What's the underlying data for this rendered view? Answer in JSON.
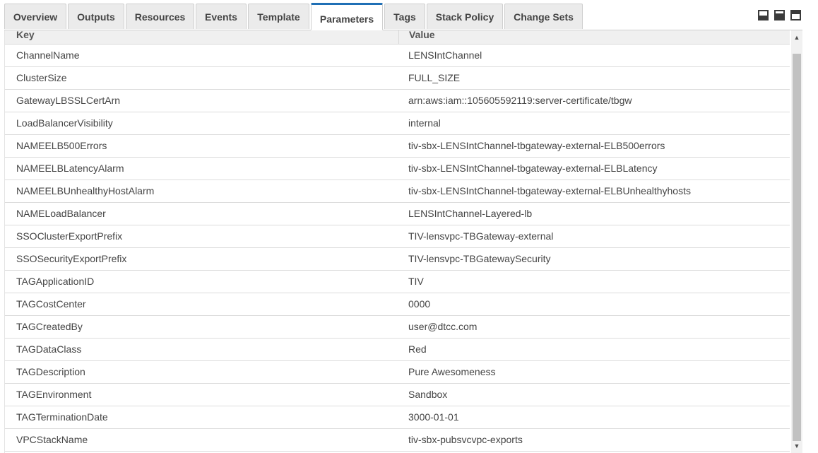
{
  "tabs": [
    {
      "label": "Overview"
    },
    {
      "label": "Outputs"
    },
    {
      "label": "Resources"
    },
    {
      "label": "Events"
    },
    {
      "label": "Template"
    },
    {
      "label": "Parameters"
    },
    {
      "label": "Tags"
    },
    {
      "label": "Stack Policy"
    },
    {
      "label": "Change Sets"
    }
  ],
  "active_tab": "Parameters",
  "table": {
    "headers": {
      "key": "Key",
      "value": "Value"
    },
    "rows": [
      {
        "key": "ChannelName",
        "value": "LENSIntChannel"
      },
      {
        "key": "ClusterSize",
        "value": "FULL_SIZE"
      },
      {
        "key": "GatewayLBSSLCertArn",
        "value": "arn:aws:iam::105605592119:server-certificate/tbgw"
      },
      {
        "key": "LoadBalancerVisibility",
        "value": "internal"
      },
      {
        "key": "NAMEELB500Errors",
        "value": "tiv-sbx-LENSIntChannel-tbgateway-external-ELB500errors"
      },
      {
        "key": "NAMEELBLatencyAlarm",
        "value": "tiv-sbx-LENSIntChannel-tbgateway-external-ELBLatency"
      },
      {
        "key": "NAMEELBUnhealthyHostAlarm",
        "value": "tiv-sbx-LENSIntChannel-tbgateway-external-ELBUnhealthyhosts"
      },
      {
        "key": "NAMELoadBalancer",
        "value": "LENSIntChannel-Layered-lb"
      },
      {
        "key": "SSOClusterExportPrefix",
        "value": "TIV-lensvpc-TBGateway-external"
      },
      {
        "key": "SSOSecurityExportPrefix",
        "value": "TIV-lensvpc-TBGatewaySecurity"
      },
      {
        "key": "TAGApplicationID",
        "value": "TIV"
      },
      {
        "key": "TAGCostCenter",
        "value": "0000"
      },
      {
        "key": "TAGCreatedBy",
        "value": "user@dtcc.com"
      },
      {
        "key": "TAGDataClass",
        "value": "Red"
      },
      {
        "key": "TAGDescription",
        "value": "Pure Awesomeness"
      },
      {
        "key": "TAGEnvironment",
        "value": "Sandbox"
      },
      {
        "key": "TAGTerminationDate",
        "value": "3000-01-01"
      },
      {
        "key": "VPCStackName",
        "value": "tiv-sbx-pubsvcvpc-exports"
      }
    ]
  },
  "window_controls": [
    {
      "icon": "minimize-panel-icon"
    },
    {
      "icon": "half-panel-icon"
    },
    {
      "icon": "maximize-panel-icon"
    }
  ],
  "scrollbar": {
    "up_glyph": "▲",
    "down_glyph": "▼"
  },
  "colors": {
    "active_tab_accent": "#1f6fb5",
    "tab_bg": "#ebebeb",
    "header_bg": "#f0f0f0"
  }
}
